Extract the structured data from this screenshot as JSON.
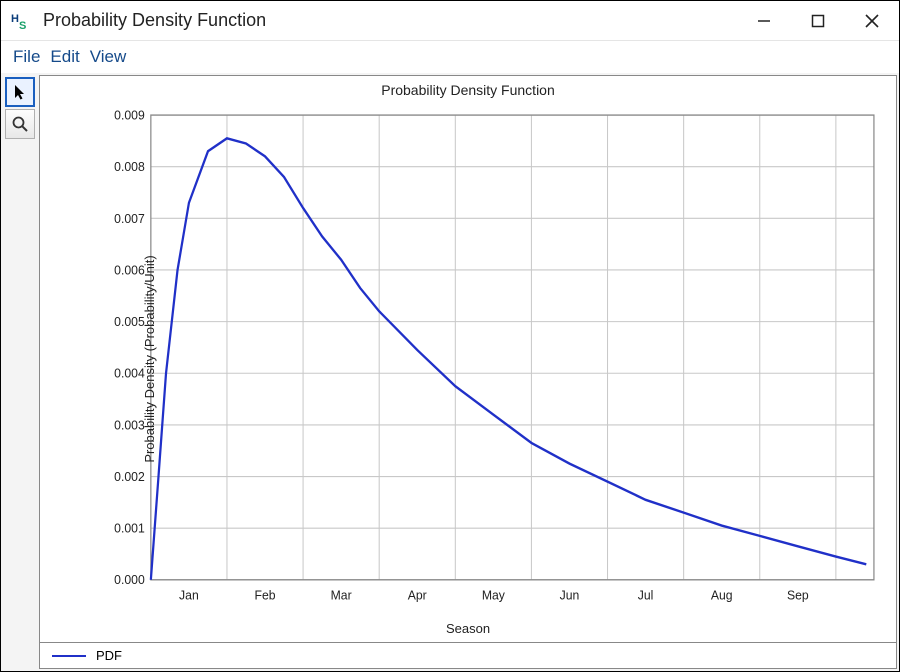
{
  "window": {
    "title": "Probability Density Function"
  },
  "menu": {
    "file": "File",
    "edit": "Edit",
    "view": "View"
  },
  "toolbar": {
    "pointer_icon": "pointer-icon",
    "zoom_icon": "magnifier-icon"
  },
  "legend": {
    "series_label": "PDF"
  },
  "chart_data": {
    "type": "line",
    "title": "Probability Density Function",
    "xlabel": "Season",
    "ylabel": "Probability Density (Probability/Unit)",
    "categories": [
      "Jan",
      "Feb",
      "Mar",
      "Apr",
      "May",
      "Jun",
      "Jul",
      "Aug",
      "Sep"
    ],
    "y_ticks": [
      0.0,
      0.001,
      0.002,
      0.003,
      0.004,
      0.005,
      0.006,
      0.007,
      0.008,
      0.009
    ],
    "ylim": [
      0.0,
      0.009
    ],
    "series": [
      {
        "name": "PDF",
        "x": [
          0.0,
          0.1,
          0.2,
          0.35,
          0.5,
          0.75,
          1.0,
          1.25,
          1.5,
          1.75,
          2.0,
          2.25,
          2.5,
          2.75,
          3.0,
          3.5,
          4.0,
          4.5,
          5.0,
          5.5,
          6.0,
          6.5,
          7.0,
          7.5,
          8.0,
          8.5,
          9.0,
          9.4
        ],
        "y": [
          0.0,
          0.002,
          0.004,
          0.006,
          0.0073,
          0.0083,
          0.00855,
          0.00845,
          0.0082,
          0.0078,
          0.0072,
          0.00665,
          0.0062,
          0.00565,
          0.0052,
          0.00445,
          0.00375,
          0.0032,
          0.00265,
          0.00225,
          0.0019,
          0.00155,
          0.0013,
          0.00105,
          0.00085,
          0.00065,
          0.00045,
          0.0003
        ]
      }
    ]
  }
}
